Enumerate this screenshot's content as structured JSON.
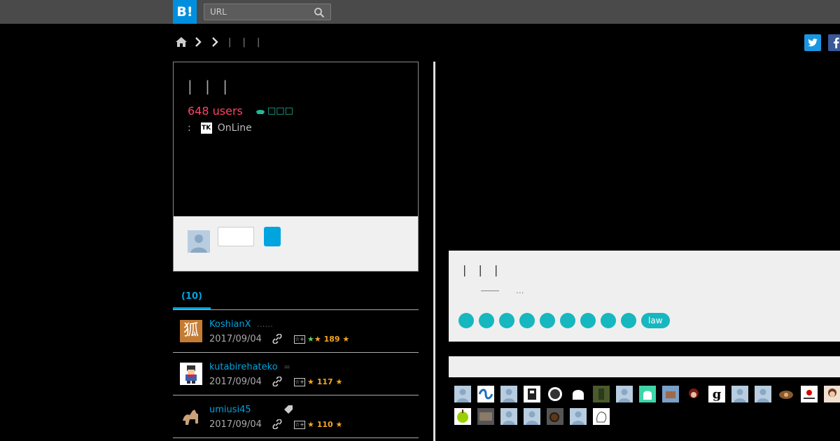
{
  "header": {
    "logo": "B!",
    "search_placeholder": "URL"
  },
  "breadcrumb": {
    "text": "| | |"
  },
  "share": {
    "twitter": "t",
    "facebook": "f"
  },
  "entry": {
    "title": "| | |",
    "users": "648 users",
    "hot_label": "□□□",
    "source_prefix": ":",
    "source_favicon": "TK",
    "source_name": "OnLine"
  },
  "tabs": {
    "label": "(10)"
  },
  "bookmarks": [
    {
      "user": "KoshianX",
      "comment": "......",
      "date": "2017/09/04",
      "stars": "189",
      "avatar_color": "#c47c34",
      "avatar_glyph": "狐"
    },
    {
      "user": "kutabirehateko",
      "comment": "=",
      "date": "2017/09/04",
      "stars": "117",
      "avatar_color": "#ffffff",
      "avatar_glyph": ""
    },
    {
      "user": "umiusi45",
      "comment": "",
      "date": "2017/09/04",
      "stars": "110",
      "avatar_color": "#000000",
      "avatar_glyph": ""
    }
  ],
  "description": {
    "title": "| | |",
    "text": "..."
  },
  "tags": {
    "law": "law"
  },
  "colors": {
    "accent": "#00a4de",
    "users": "#ff4166",
    "tag": "#16b7bf"
  }
}
